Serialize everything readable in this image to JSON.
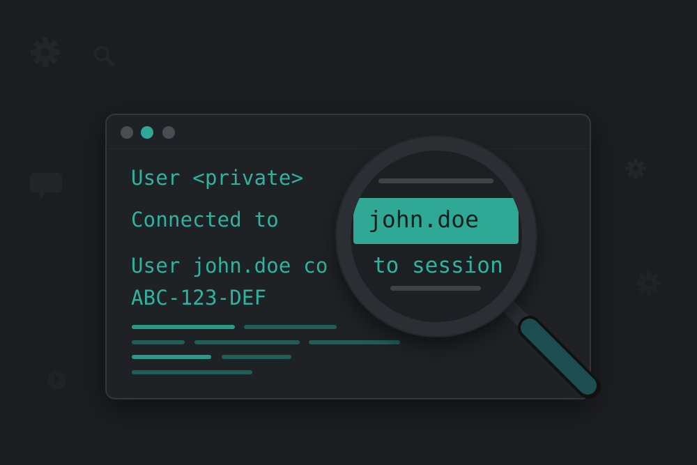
{
  "background_icons": [
    "gear-icon",
    "search-icon",
    "chat-bubble-icon",
    "gear-icon",
    "gear-icon",
    "play-circle-icon"
  ],
  "window": {
    "controls": [
      "close-dot",
      "active-dot",
      "maximize-dot"
    ],
    "log": {
      "line1": "User <private>",
      "line2": "Connected to",
      "line3": "User john.doe co",
      "line4": "ABC-123-DEF"
    }
  },
  "magnifier": {
    "highlighted_text": "john.doe",
    "text_below": "to session"
  },
  "colors": {
    "background": "#1b1d20",
    "window": "#1f2225",
    "accent": "#2fb39e",
    "highlight": "#2fa896",
    "handle": "#1d4e52"
  }
}
